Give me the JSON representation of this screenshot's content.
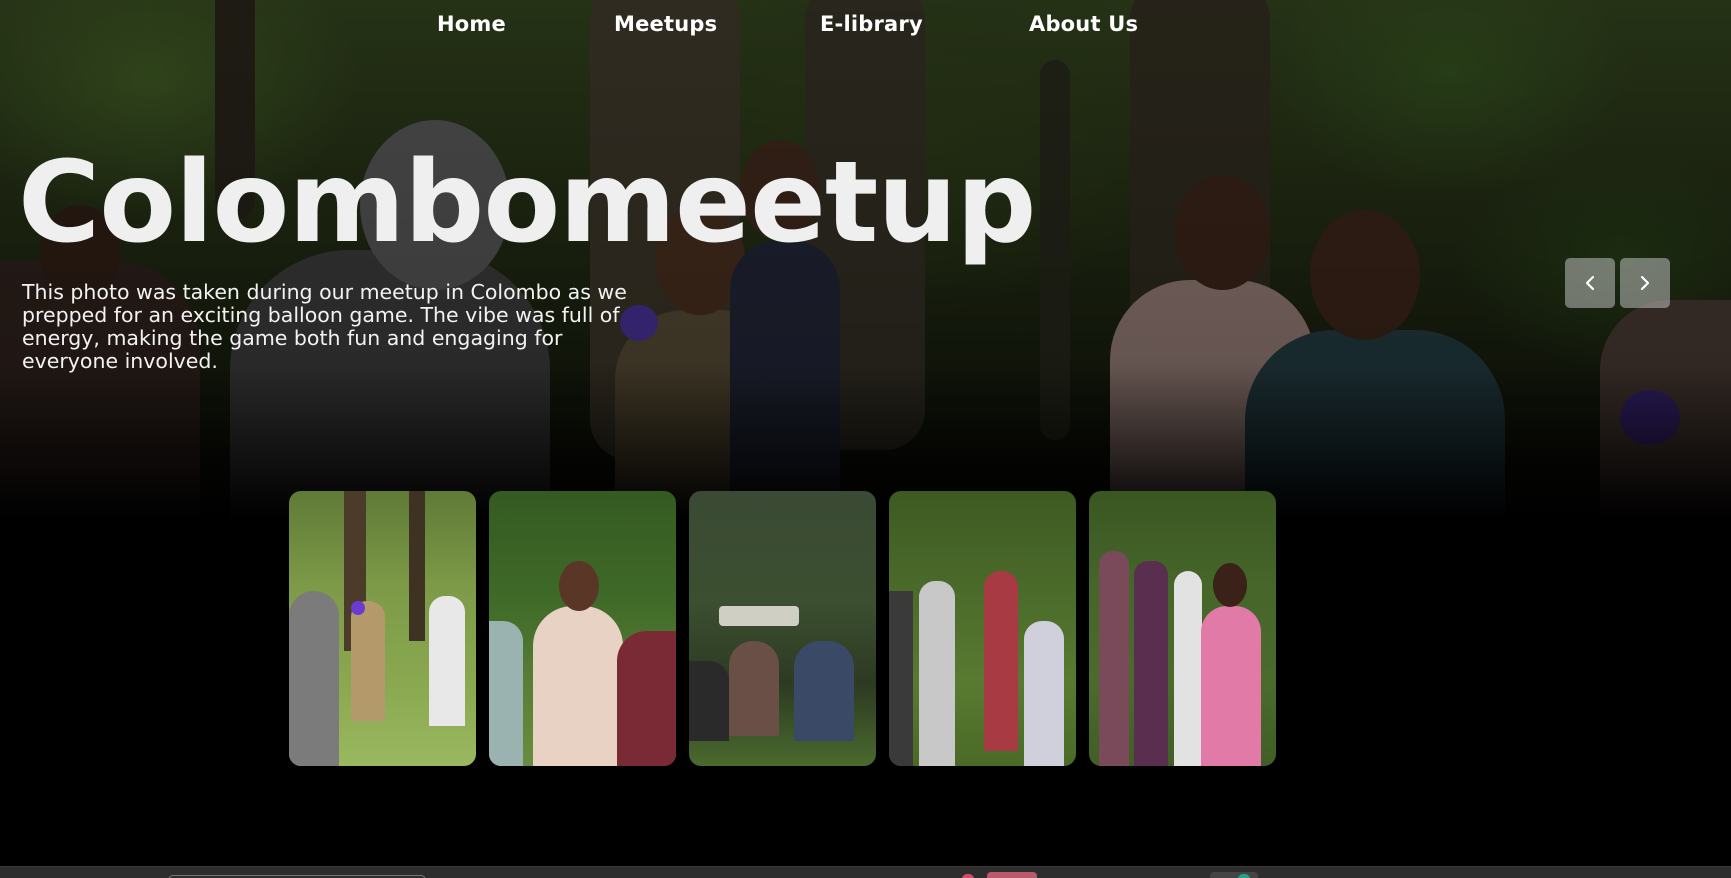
{
  "nav": {
    "items": [
      {
        "label": "Home"
      },
      {
        "label": "Meetups"
      },
      {
        "label": "E-library"
      },
      {
        "label": "About Us"
      }
    ]
  },
  "hero": {
    "title": "Colombomeetup",
    "description": "This photo was taken during our meetup in Colombo as we prepped for an exciting balloon game. The vibe was full of energy, making the game both fun and engaging for everyone involved."
  },
  "carousel": {
    "prev_icon": "chevron-left-icon",
    "next_icon": "chevron-right-icon",
    "thumbnails": [
      {
        "name": "thumbnail-balloon-game"
      },
      {
        "name": "thumbnail-smiling-girls"
      },
      {
        "name": "thumbnail-group-sitting"
      },
      {
        "name": "thumbnail-crowd-park"
      },
      {
        "name": "thumbnail-crowd-pink-shirt"
      }
    ]
  },
  "colors": {
    "background": "#000000",
    "title": "#efefef",
    "nav_text": "#ffffff",
    "arrow_bg": "#bebebe"
  }
}
